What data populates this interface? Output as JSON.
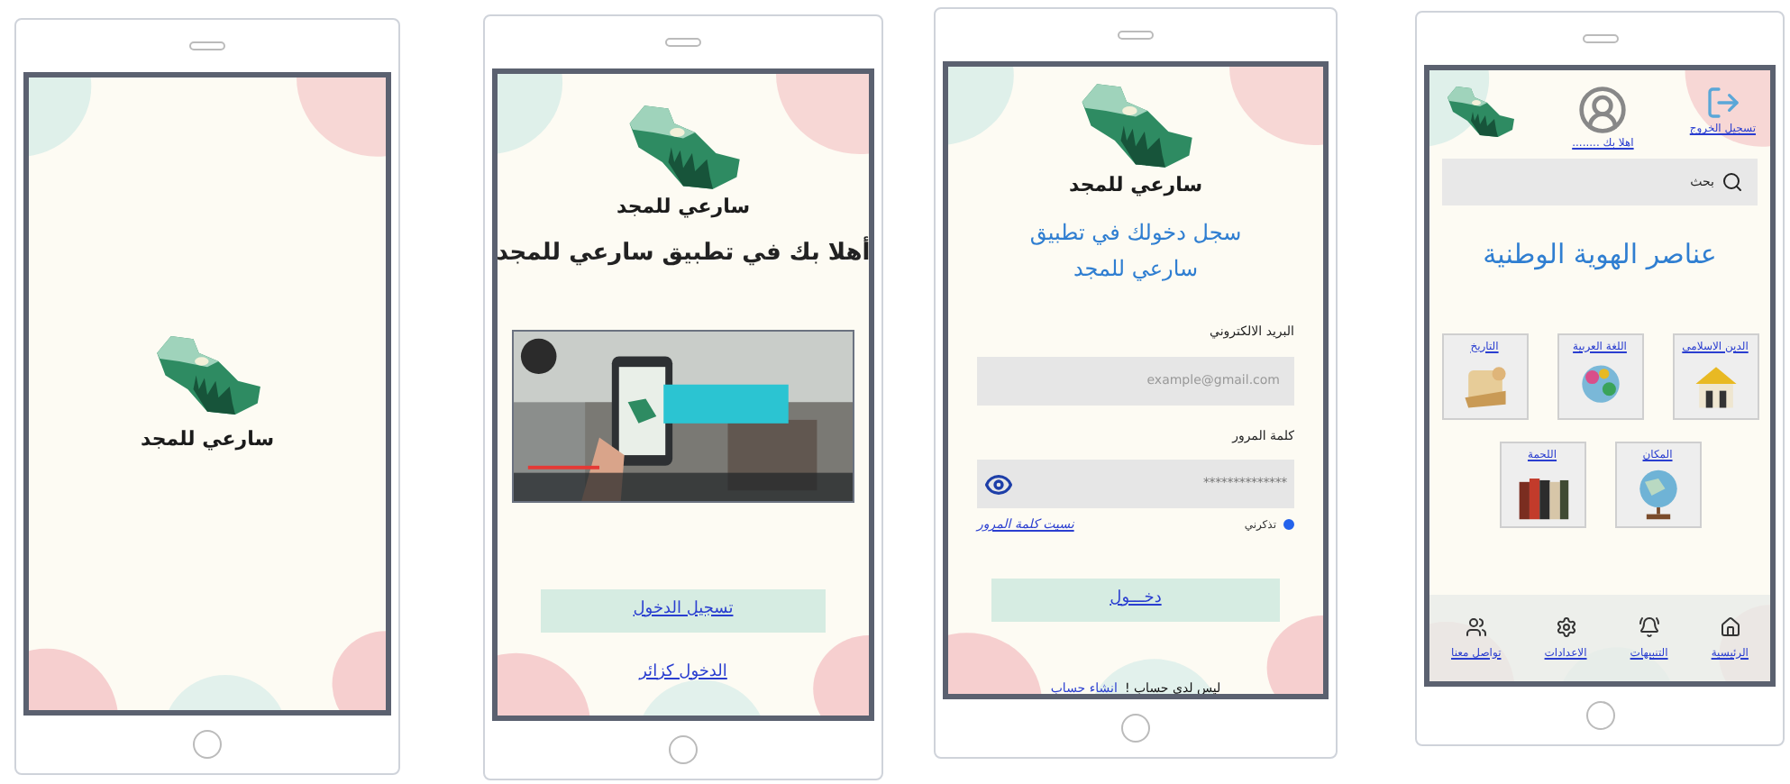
{
  "splash_screen": {
    "logo_text": "سارعي للمجد"
  },
  "welcome_screen": {
    "logo_text": "سارعي للمجد",
    "heading": "أهلا بك في تطبيق سارعي للمجد",
    "login_button": "تسجيل الدخول",
    "guest_link": "الدخول كزائر"
  },
  "login_screen": {
    "logo_text": "سارعي للمجد",
    "heading": [
      "سجل دخولك في تطبيق",
      "سارعي للمجد"
    ],
    "email_label": "البريد الالكتروني",
    "email_placeholder": "example@gmail.com",
    "password_label": "كلمة المرور",
    "password_value": "**************",
    "remember": {
      "label": "تذكرني",
      "checked": true
    },
    "forgot_link": "نسيت كلمة المرور",
    "submit_button": "دخـــول",
    "signup_prompt": "ليس لدي حساب !",
    "signup_link": "انشاء حساب"
  },
  "home_screen": {
    "logout_label": "تسجيل الخروج",
    "greeting": "اهلا بك ........",
    "search_placeholder": "بحث",
    "heading": "عناصر الهوية الوطنية",
    "cards": [
      {
        "label": "الدين الاسلامي"
      },
      {
        "label": "اللغة العربية"
      },
      {
        "label": "التاريخ"
      },
      {
        "label": "المكان"
      },
      {
        "label": "اللحمة"
      }
    ],
    "nav": [
      {
        "label": "الرئيسية"
      },
      {
        "label": "التنبيهات"
      },
      {
        "label": "الاعدادات"
      },
      {
        "label": "تواصل معنا"
      }
    ]
  }
}
